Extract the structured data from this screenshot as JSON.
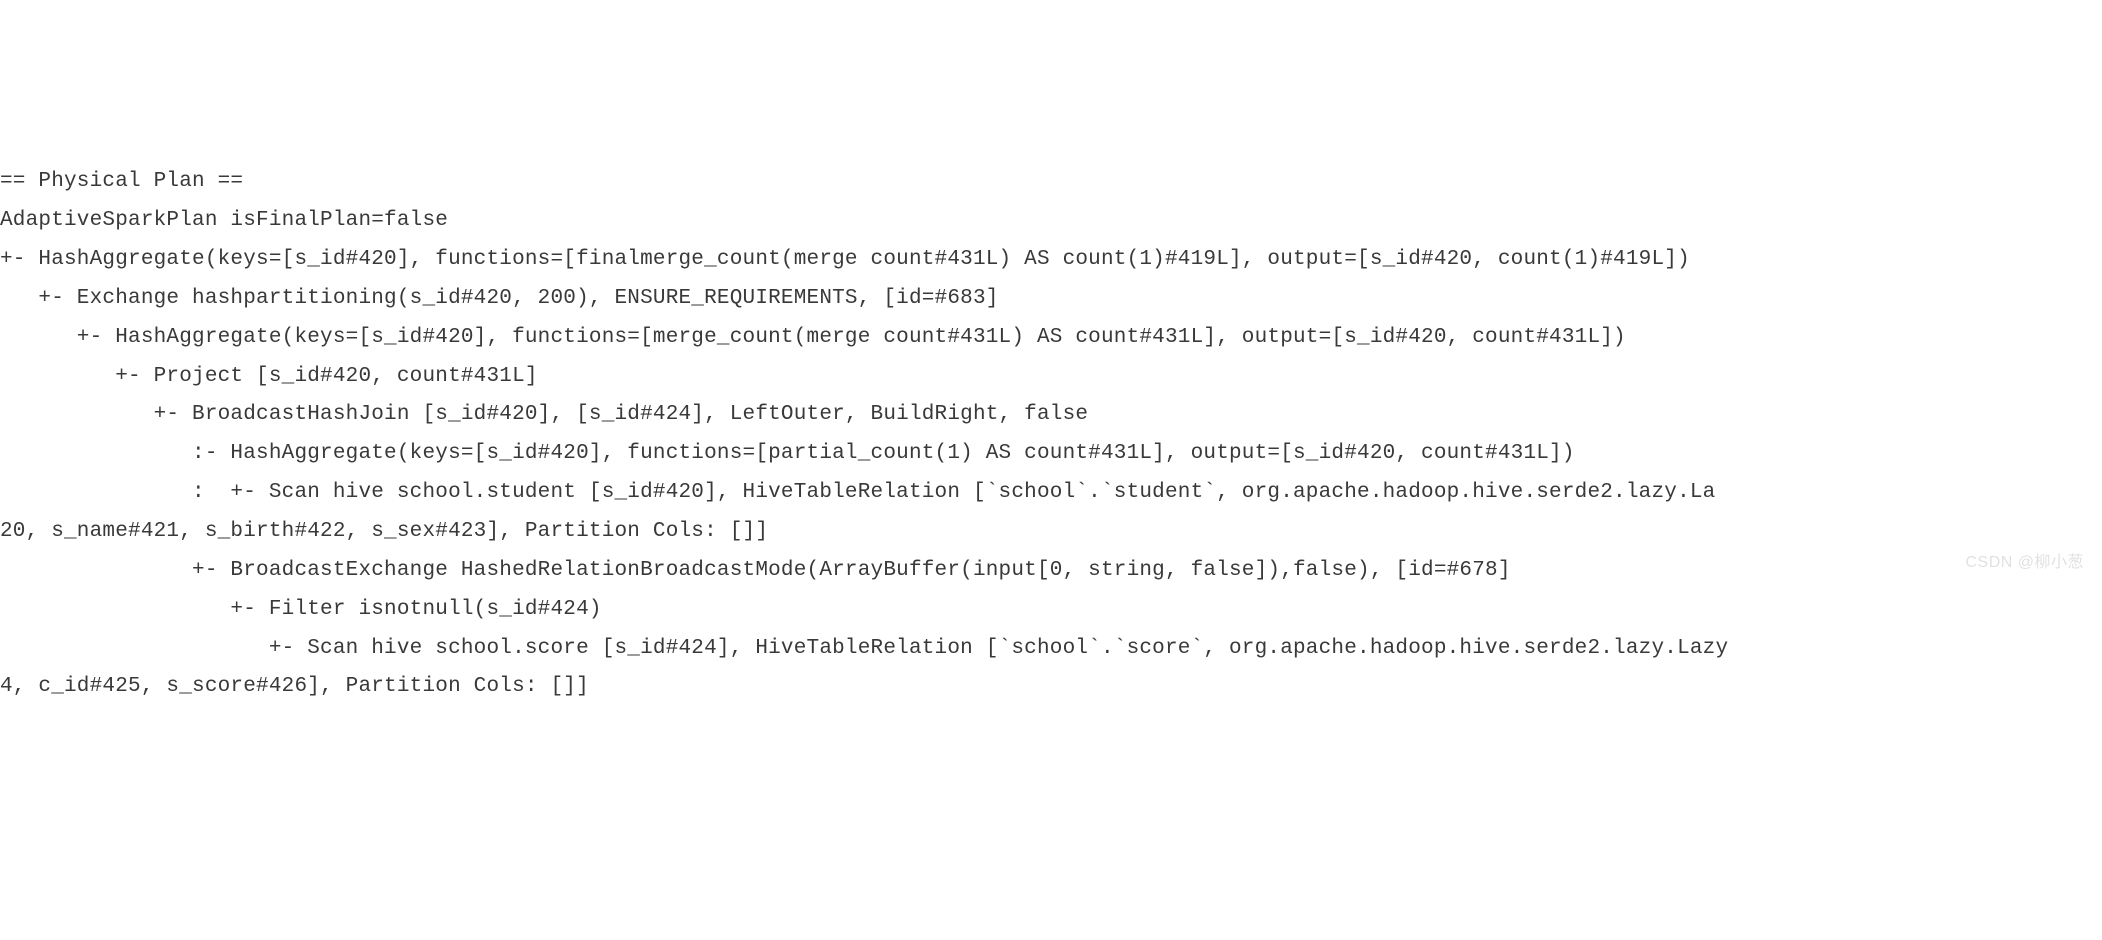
{
  "plan_text": "== Physical Plan ==\nAdaptiveSparkPlan isFinalPlan=false\n+- HashAggregate(keys=[s_id#420], functions=[finalmerge_count(merge count#431L) AS count(1)#419L], output=[s_id#420, count(1)#419L])\n   +- Exchange hashpartitioning(s_id#420, 200), ENSURE_REQUIREMENTS, [id=#683]\n      +- HashAggregate(keys=[s_id#420], functions=[merge_count(merge count#431L) AS count#431L], output=[s_id#420, count#431L])\n         +- Project [s_id#420, count#431L]\n            +- BroadcastHashJoin [s_id#420], [s_id#424], LeftOuter, BuildRight, false\n               :- HashAggregate(keys=[s_id#420], functions=[partial_count(1) AS count#431L], output=[s_id#420, count#431L])\n               :  +- Scan hive school.student [s_id#420], HiveTableRelation [`school`.`student`, org.apache.hadoop.hive.serde2.lazy.La\n20, s_name#421, s_birth#422, s_sex#423], Partition Cols: []]\n               +- BroadcastExchange HashedRelationBroadcastMode(ArrayBuffer(input[0, string, false]),false), [id=#678]\n                  +- Filter isnotnull(s_id#424)\n                     +- Scan hive school.score [s_id#424], HiveTableRelation [`school`.`score`, org.apache.hadoop.hive.serde2.lazy.Lazy\n4, c_id#425, s_score#426], Partition Cols: []]",
  "watermark": "CSDN @柳小葱"
}
